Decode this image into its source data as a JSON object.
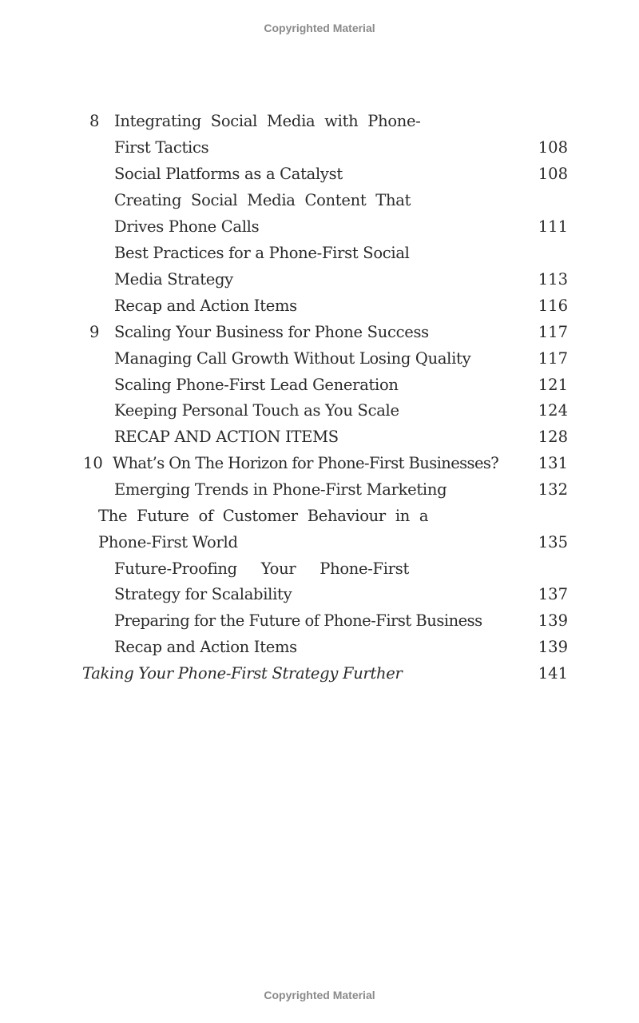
{
  "watermark": {
    "top": "Copyrighted Material",
    "bottom": "Copyrighted Material"
  },
  "toc": {
    "entries": [
      {
        "number": "8",
        "lines": [
          "Integrating Social Media with Phone-",
          "First Tactics"
        ],
        "page": "108",
        "level": "chapter"
      },
      {
        "lines": [
          "Social Platforms as a Catalyst"
        ],
        "page": "108",
        "level": "section"
      },
      {
        "lines": [
          "Creating Social Media Content That",
          "Drives Phone Calls"
        ],
        "page": "111",
        "level": "section"
      },
      {
        "lines": [
          "Best Practices for a Phone-First Social",
          "Media Strategy"
        ],
        "page": "113",
        "level": "section"
      },
      {
        "lines": [
          "Recap and Action Items"
        ],
        "page": "116",
        "level": "section"
      },
      {
        "number": "9",
        "lines": [
          "Scaling Your Business for Phone Success"
        ],
        "page": "117",
        "level": "chapter"
      },
      {
        "lines": [
          "Managing Call Growth Without Losing Quality"
        ],
        "page": "117",
        "level": "section"
      },
      {
        "lines": [
          "Scaling Phone-First Lead Generation"
        ],
        "page": "121",
        "level": "section"
      },
      {
        "lines": [
          "Keeping Personal Touch as You Scale"
        ],
        "page": "124",
        "level": "section"
      },
      {
        "lines": [
          "RECAP AND ACTION ITEMS"
        ],
        "page": "128",
        "level": "section"
      },
      {
        "number": "10",
        "lines": [
          "What’s On The Horizon for Phone-First Businesses?"
        ],
        "page": "131",
        "level": "chapter"
      },
      {
        "lines": [
          "Emerging Trends in Phone-First Marketing"
        ],
        "page": "132",
        "level": "section"
      },
      {
        "lines": [
          "The Future of Customer Behaviour in a",
          "Phone-First World"
        ],
        "page": "135",
        "level": "section-outdented"
      },
      {
        "lines": [
          "Future-Proofing Your Phone-First",
          "Strategy for Scalability"
        ],
        "page": "137",
        "level": "section"
      },
      {
        "lines": [
          "Preparing for the Future of Phone-First Business"
        ],
        "page": "139",
        "level": "section"
      },
      {
        "lines": [
          "Recap and Action Items"
        ],
        "page": "139",
        "level": "section"
      },
      {
        "lines": [
          "Taking Your Phone-First Strategy Further"
        ],
        "page": "141",
        "level": "backmatter"
      }
    ]
  }
}
